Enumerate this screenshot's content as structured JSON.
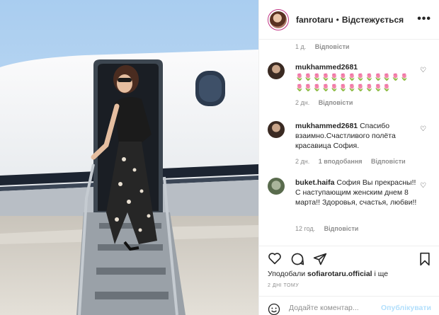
{
  "header": {
    "username": "fanrotaru",
    "separator": "•",
    "follow_status": "Відстежується",
    "more_icon": "more-dots-icon"
  },
  "comments": [
    {
      "time": "1 д.",
      "reply": "Відповісти"
    },
    {
      "username": "mukhammed2681",
      "text": "🌷🌷🌷🌷🌷🌷🌷🌷🌷🌷🌷🌷🌷🌷🌷🌷🌷🌷🌷🌷🌷🌷🌷🌷",
      "time": "2 дн.",
      "reply": "Відповісти"
    },
    {
      "username": "mukhammed2681",
      "text": "Спасибо взаимно.Счастливого полёта красавица София.",
      "time": "2 дн.",
      "likes": "1 вподобання",
      "reply": "Відповісти"
    },
    {
      "username": "buket.haifa",
      "text": "София Вы прекрасны!!С наступающим женским днем 8 марта!! Здоровья, счастья, любви!!",
      "time": "12 год.",
      "reply": "Відповісти"
    }
  ],
  "likes_line": {
    "prefix": "Уподобали",
    "user": "sofiarotaru.official",
    "suffix": "і ще"
  },
  "time_ago": "2 ДНІ ТОМУ",
  "add_comment": {
    "placeholder": "Додайте коментар...",
    "post_label": "Опублікувати"
  },
  "colors": {
    "accent": "#0095f6",
    "post_disabled": "#b2dffc",
    "muted": "#8e8e8e",
    "text": "#262626"
  }
}
